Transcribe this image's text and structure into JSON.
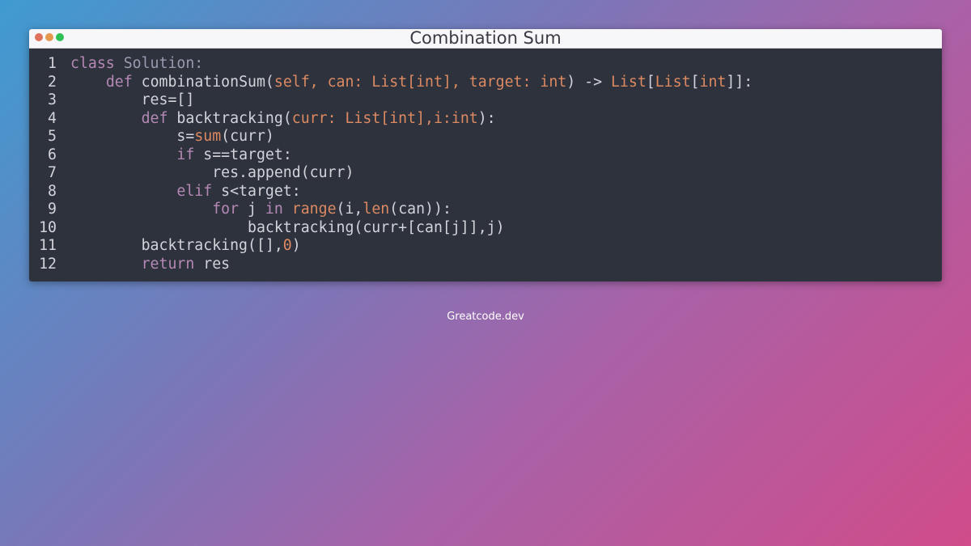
{
  "window": {
    "title": "Combination Sum",
    "controls": [
      "close",
      "minimize",
      "maximize"
    ]
  },
  "code": {
    "lines": [
      {
        "num": "1",
        "tokens": [
          {
            "t": "class ",
            "k": "kw"
          },
          {
            "t": "Solution:",
            "k": "cls"
          }
        ]
      },
      {
        "num": "2",
        "tokens": [
          {
            "t": "    ",
            "k": "pl"
          },
          {
            "t": "def ",
            "k": "kw"
          },
          {
            "t": "combinationSum(",
            "k": "pl"
          },
          {
            "t": "self, can: List[int], target: int",
            "k": "ar"
          },
          {
            "t": ") -> ",
            "k": "pl"
          },
          {
            "t": "List",
            "k": "ar"
          },
          {
            "t": "[",
            "k": "pl"
          },
          {
            "t": "List",
            "k": "ar"
          },
          {
            "t": "[",
            "k": "pl"
          },
          {
            "t": "int",
            "k": "ar"
          },
          {
            "t": "]]:",
            "k": "pl"
          }
        ]
      },
      {
        "num": "3",
        "tokens": [
          {
            "t": "        res=[]",
            "k": "pl"
          }
        ]
      },
      {
        "num": "4",
        "tokens": [
          {
            "t": "        ",
            "k": "pl"
          },
          {
            "t": "def ",
            "k": "kw"
          },
          {
            "t": "backtracking(",
            "k": "pl"
          },
          {
            "t": "curr: List[int],i:int",
            "k": "ar"
          },
          {
            "t": "):",
            "k": "pl"
          }
        ]
      },
      {
        "num": "5",
        "tokens": [
          {
            "t": "            s=",
            "k": "pl"
          },
          {
            "t": "sum",
            "k": "fn"
          },
          {
            "t": "(curr)",
            "k": "pl"
          }
        ]
      },
      {
        "num": "6",
        "tokens": [
          {
            "t": "            ",
            "k": "pl"
          },
          {
            "t": "if ",
            "k": "kw"
          },
          {
            "t": "s==target:",
            "k": "pl"
          }
        ]
      },
      {
        "num": "7",
        "tokens": [
          {
            "t": "                res.append(curr)",
            "k": "pl"
          }
        ]
      },
      {
        "num": "8",
        "tokens": [
          {
            "t": "            ",
            "k": "pl"
          },
          {
            "t": "elif ",
            "k": "kw"
          },
          {
            "t": "s<target:",
            "k": "pl"
          }
        ]
      },
      {
        "num": "9",
        "tokens": [
          {
            "t": "                ",
            "k": "pl"
          },
          {
            "t": "for ",
            "k": "kw"
          },
          {
            "t": "j ",
            "k": "pl"
          },
          {
            "t": "in ",
            "k": "kw"
          },
          {
            "t": "range",
            "k": "fn"
          },
          {
            "t": "(i,",
            "k": "pl"
          },
          {
            "t": "len",
            "k": "fn"
          },
          {
            "t": "(can)):",
            "k": "pl"
          }
        ]
      },
      {
        "num": "10",
        "tokens": [
          {
            "t": "                    backtracking(curr+[can[j]],j)",
            "k": "pl"
          }
        ]
      },
      {
        "num": "11",
        "tokens": [
          {
            "t": "        backtracking([],",
            "k": "pl"
          },
          {
            "t": "0",
            "k": "fn"
          },
          {
            "t": ")",
            "k": "pl"
          }
        ]
      },
      {
        "num": "12",
        "tokens": [
          {
            "t": "        ",
            "k": "pl"
          },
          {
            "t": "return ",
            "k": "kw"
          },
          {
            "t": "res",
            "k": "pl"
          }
        ]
      }
    ]
  },
  "footer": {
    "text": "Greatcode.dev"
  },
  "colors": {
    "keyword": "#b589b5",
    "argument": "#dd8a62",
    "plain": "#d3d3da",
    "editor_bg": "#2e323d"
  }
}
